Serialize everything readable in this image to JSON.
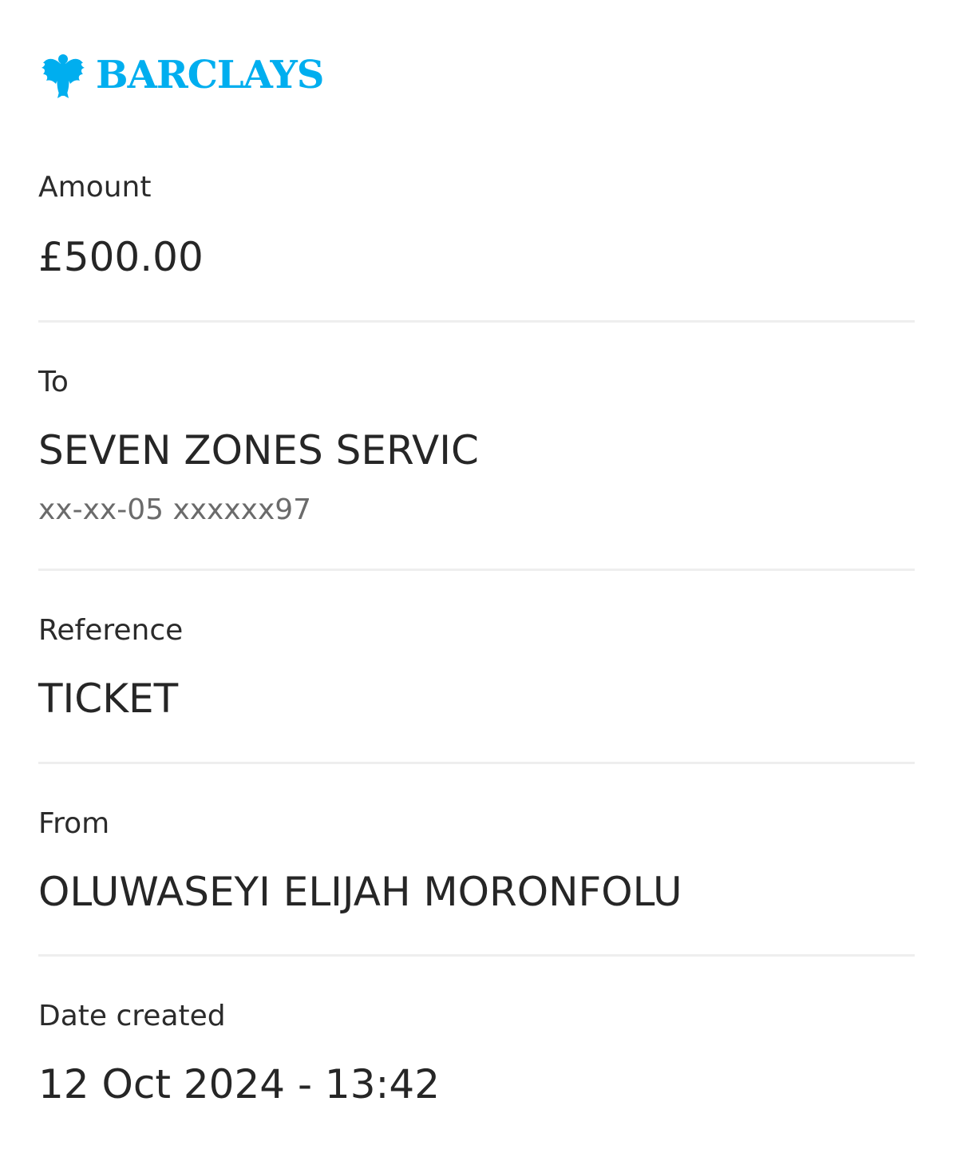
{
  "brand": {
    "name": "BARCLAYS",
    "color": "#00AEEF",
    "logo_icon": "eagle-icon"
  },
  "fields": {
    "amount": {
      "label": "Amount",
      "value": "£500.00"
    },
    "to": {
      "label": "To",
      "value": "SEVEN ZONES SERVIC",
      "account": "xx-xx-05 xxxxxx97"
    },
    "reference": {
      "label": "Reference",
      "value": "TICKET"
    },
    "from": {
      "label": "From",
      "value": "OLUWASEYI ELIJAH MORONFOLU"
    },
    "date_created": {
      "label": "Date created",
      "value": "12 Oct 2024 - 13:42"
    }
  }
}
